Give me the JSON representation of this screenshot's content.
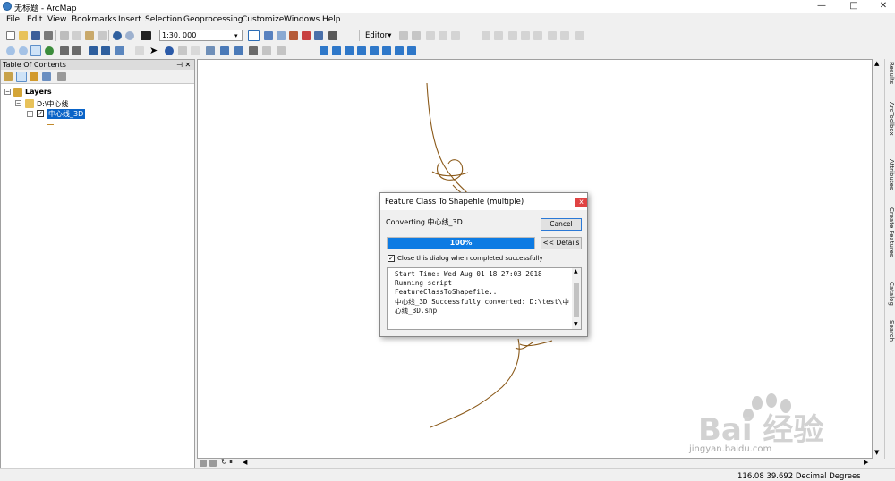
{
  "app": {
    "title": "无标题 - ArcMap",
    "window_controls": [
      "—",
      "□",
      "✕"
    ]
  },
  "menu": [
    "File",
    "Edit",
    "View",
    "Bookmarks",
    "Insert",
    "Selection",
    "Geoprocessing",
    "Customize",
    "Windows",
    "Help"
  ],
  "toolbar": {
    "scale_value": "1:30, 000",
    "editor_label": "Editor"
  },
  "toc": {
    "title": "Table Of Contents",
    "pin_glyph": "⊣ ✕",
    "layers_label": "Layers",
    "folder_label": "D:\\中心线",
    "layer_label": "中心线_3D"
  },
  "map": {
    "line_color": "#8b5a1a"
  },
  "right_dock": {
    "tabs": [
      "Results",
      "ArcToolbox",
      "Attributes",
      "Create Features",
      "Catalog",
      "Search"
    ]
  },
  "status": {
    "coordinates": "116.08  39.692 Decimal Degrees"
  },
  "dialog": {
    "title": "Feature Class To Shapefile (multiple)",
    "close_label": "x",
    "converting_text": "Converting 中心线_3D",
    "cancel_label": "Cancel",
    "details_label": "<< Details",
    "progress_percent": 100,
    "progress_text": "100%",
    "checkbox_checked": true,
    "checkbox_label": "Close this dialog when completed successfully",
    "log_lines": [
      "Start Time: Wed Aug 01 18:27:03 2018",
      "Running script",
      "FeatureClassToShapefile...",
      "中心线_3D Successfully converted:  D:\\test\\中",
      "心线_3D.shp"
    ]
  },
  "watermark": {
    "logo_text": "Bai 经验",
    "url_text": "jingyan.baidu.com"
  }
}
